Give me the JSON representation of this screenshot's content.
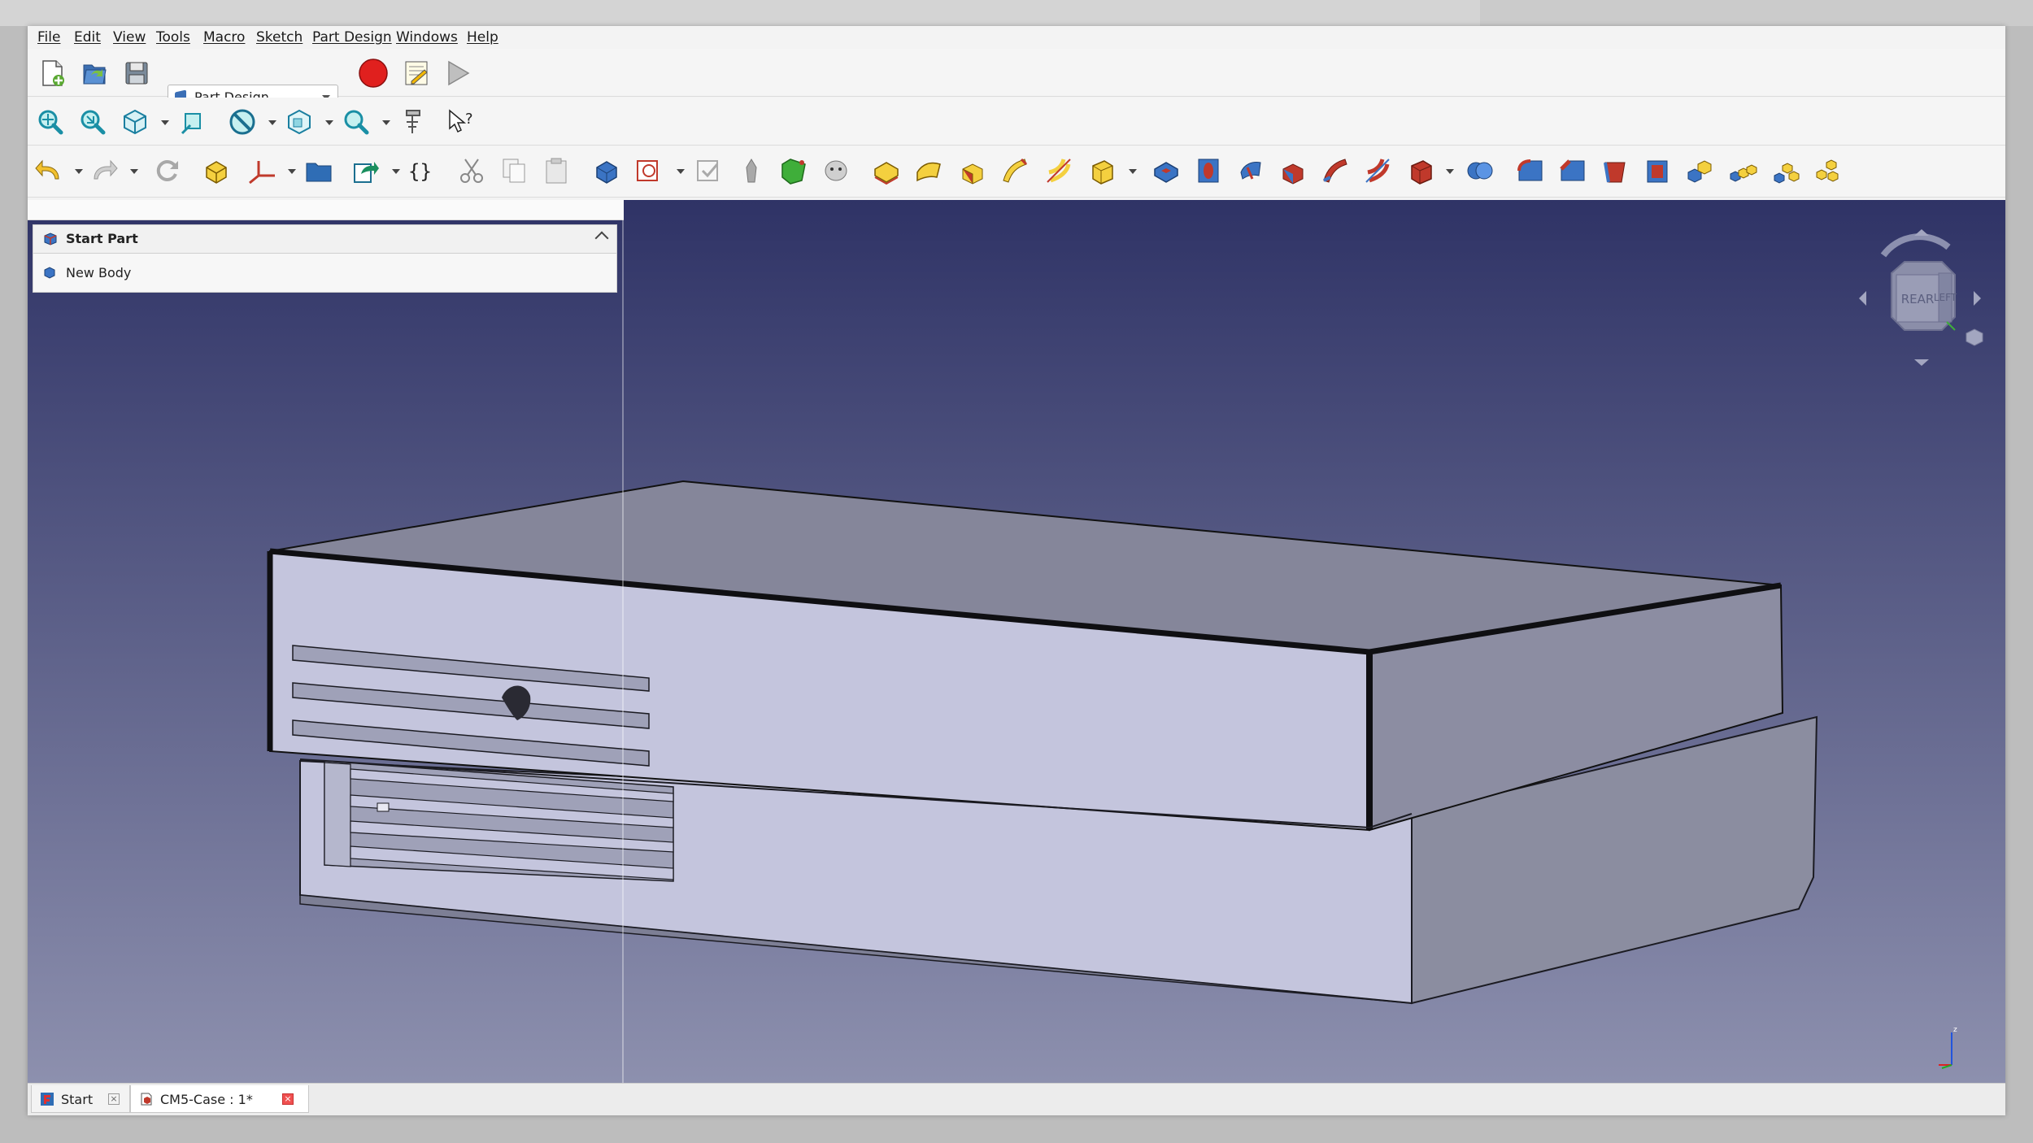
{
  "menu": [
    "File",
    "Edit",
    "View",
    "Tools",
    "Macro",
    "Sketch",
    "Part Design",
    "Windows",
    "Help"
  ],
  "toolbar": {
    "workbench_selected": "Part Design",
    "file_icons": [
      "new-file-icon",
      "open-file-icon",
      "save-icon"
    ],
    "macro_icons": [
      "record-macro-icon",
      "macro-editor-icon",
      "run-macro-icon"
    ],
    "view_icons": [
      "fit-all-icon",
      "fit-selection-icon",
      "isometric-view-icon",
      "std-views-icon",
      "draw-style-icon",
      "stereo-icon",
      "zoom-icon",
      "measure-icon",
      "whats-this-icon"
    ],
    "edit_icons": [
      "undo-icon",
      "redo-icon",
      "refresh-icon",
      "part-container-icon",
      "datum-icon",
      "group-icon",
      "link-icon",
      "expression-icon",
      "cut-icon",
      "copy-icon",
      "paste-icon"
    ],
    "partdesign_icons": [
      "create-body-icon",
      "create-sketch-icon",
      "validate-sketch-icon",
      "shape-binder-icon",
      "clone-icon",
      "sub-shape-binder-icon",
      "pad-icon",
      "revolution-icon",
      "loft-icon",
      "pipe-icon",
      "helix-icon",
      "additive-primitive-icon",
      "pocket-icon",
      "hole-icon",
      "groove-icon",
      "subtractive-loft-icon",
      "subtractive-pipe-icon",
      "subtractive-helix-icon",
      "subtractive-primitive-icon",
      "boolean-icon",
      "fillet-icon",
      "chamfer-icon",
      "draft-icon",
      "thickness-icon",
      "mirrored-icon",
      "linear-pattern-icon",
      "polar-pattern-icon",
      "multi-transform-icon"
    ]
  },
  "taskpanel": {
    "title": "Start Part",
    "items": [
      {
        "label": "New Body"
      }
    ]
  },
  "navcube": {
    "face_rear": "REAR",
    "face_left": "LEFT"
  },
  "axis": {
    "z_label": "z"
  },
  "tabs": [
    {
      "label": "Start",
      "active": false
    },
    {
      "label": "CM5-Case : 1*",
      "active": true
    }
  ],
  "colors": {
    "viewport_top": "#2f3366",
    "viewport_bottom": "#8d90ae",
    "model_face": "#c4c5dd",
    "model_side": "#8b8da0",
    "model_top": "#85869a",
    "record_red": "#e0201e"
  }
}
